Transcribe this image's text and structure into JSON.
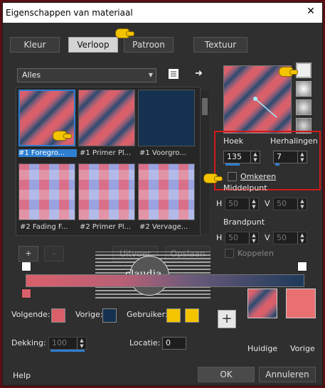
{
  "window": {
    "title": "Eigenschappen van materiaal",
    "close": "✕"
  },
  "tabs": [
    {
      "label": "Kleur"
    },
    {
      "label": "Verloop"
    },
    {
      "label": "Patroon"
    },
    {
      "label": "Textuur"
    }
  ],
  "category": {
    "value": "Alles"
  },
  "swatches": [
    {
      "label": "#1 Foregro..."
    },
    {
      "label": "#1 Primer Pl..."
    },
    {
      "label": "#1 Voorgro..."
    },
    {
      "label": "#2 Fading F..."
    },
    {
      "label": "#2 Primer Pl..."
    },
    {
      "label": "#2 Vervage..."
    }
  ],
  "list_buttons": {
    "add": "+",
    "remove": "-",
    "import": "Uitvoer",
    "export": "Opslaan"
  },
  "settings": {
    "angle_label": "Hoek",
    "angle_value": "135",
    "repeats_label": "Herhalingen",
    "repeats_value": "7",
    "invert_label": "Omkeren",
    "midpoint_label": "Middelpunt",
    "h_label": "H",
    "v_label": "V",
    "mid_h": "50",
    "mid_v": "50",
    "focal_label": "Brandpunt",
    "focal_h": "50",
    "focal_v": "50",
    "link_label": "Koppelen"
  },
  "watermark": {
    "text": "claudia"
  },
  "bottom": {
    "next_label": "Volgende:",
    "prev_label": "Vorige:",
    "user_label": "Gebruiker:",
    "opacity_label": "Dekking:",
    "opacity_value": "100",
    "location_label": "Locatie:",
    "location_value": "0",
    "current_label": "Huidige",
    "previous_label": "Vorige"
  },
  "footer": {
    "help": "Help",
    "ok": "OK",
    "cancel": "Annuleren"
  },
  "colors": {
    "pink": "#d9606b",
    "navy": "#14324f",
    "yellow": "#f4c400",
    "selection": "#2e7fd0"
  }
}
